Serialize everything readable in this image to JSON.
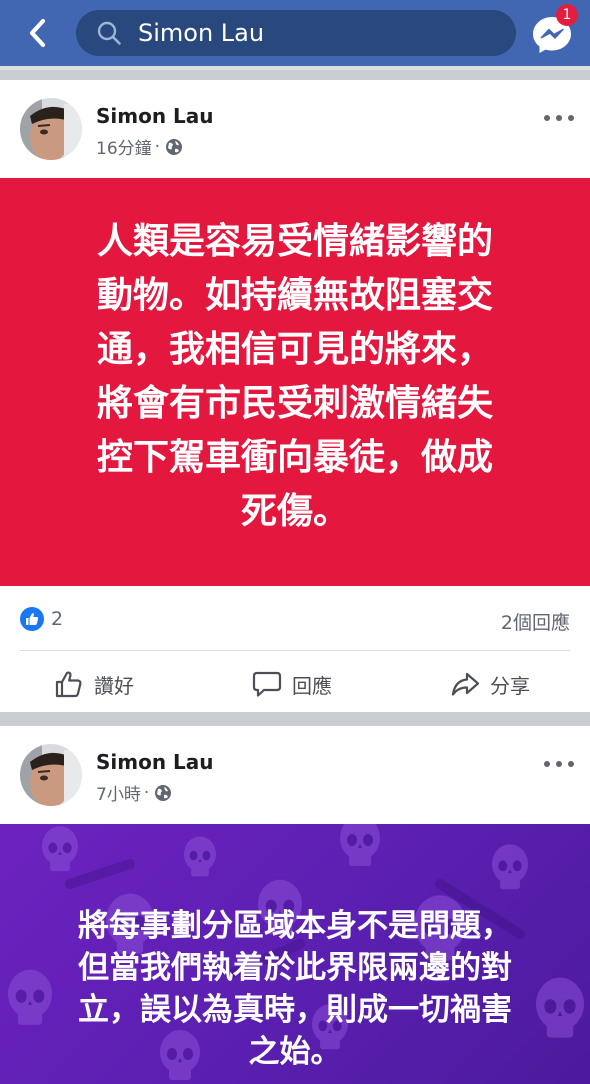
{
  "search": {
    "query": "Simon Lau"
  },
  "header": {
    "messenger_badge": "1"
  },
  "posts": [
    {
      "author": "Simon Lau",
      "time": "16分鐘",
      "separator": "·",
      "background_color": "#e4173f",
      "text": "人類是容易受情緒影響的\n動物。如持續無故阻塞交\n通，我相信可見的將來，\n將會有市民受刺激情緒失\n控下駕車衝向暴徒，做成\n死傷。",
      "like_count": "2",
      "comment_count": "2個回應",
      "actions": {
        "like": "讚好",
        "comment": "回應",
        "share": "分享"
      }
    },
    {
      "author": "Simon Lau",
      "time": "7小時",
      "separator": "·",
      "background_color": "#6d22c0",
      "text": "將每事劃分區域本身不是問題，\n但當我們執着於此界限兩邊的對\n立，誤以為真時，則成一切禍害\n之始。"
    }
  ],
  "colors": {
    "navbar": "#4267b2",
    "search_field": "#29487d",
    "like_blue": "#1877f2",
    "badge_red": "#e41e3f"
  },
  "icons": {
    "back": "chevron-left-icon",
    "search": "magnifier-icon",
    "messenger": "messenger-icon",
    "privacy": "globe-icon",
    "more": "ellipsis-icon",
    "like": "thumbs-up-icon",
    "comment": "speech-bubble-icon",
    "share": "share-arrow-icon"
  }
}
